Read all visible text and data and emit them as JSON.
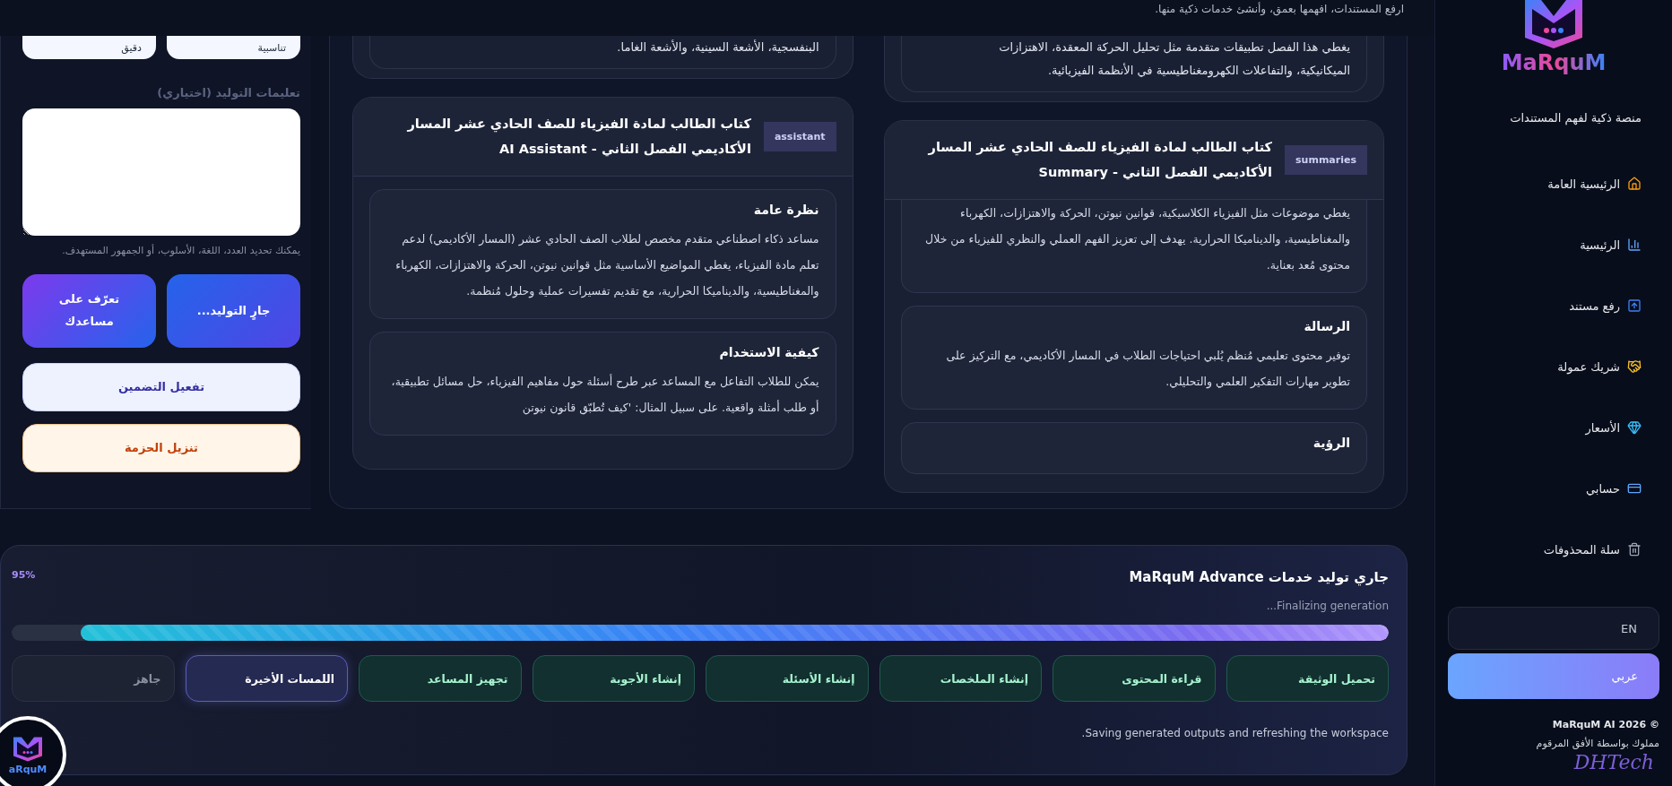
{
  "header": {
    "tagline": "ارفع المستندات، افهمها بعمق، وأنشئ خدمات ذكية منها."
  },
  "options_panel": {
    "choices": [
      {
        "label": "تناسبية"
      },
      {
        "label": "دقيق"
      }
    ],
    "instructions": {
      "label": "تعليمات التوليد (اختياري)",
      "hint": "يمكنك تحديد العدد، اللغة، الأسلوب، أو الجمهور المستهدف."
    },
    "actions": [
      {
        "label": "جارٍ التوليد...",
        "kind": "primary"
      },
      {
        "label": "تعرّف على مساعدك",
        "kind": "accent"
      },
      {
        "label": "تفعيل التضمين",
        "kind": "light"
      },
      {
        "label": "تنزيل الحزمة",
        "kind": "warm"
      }
    ]
  },
  "results": [
    {
      "previous_lines": [
        "يغطي هذا الفصل تطبيقات متقدمة مثل تحليل الحركة المعقدة، الاهتزازات",
        "الميكانيكية، والتفاعلات الكهرومغناطيسية في الأنظمة الفيزيائية."
      ],
      "badge": "summaries",
      "title": "كتاب الطالب لمادة الفيزياء للصف الحادي عشر المسار الأكاديمي الفصل الثاني - Summary",
      "sections": [
        {
          "text": "يغطي موضوعات مثل الفيزياء الكلاسيكية، قوانين نيوتن، الحركة والاهتزازات، الكهرباء والمغناطيسية، والديناميكا الحرارية. يهدف إلى تعزيز الفهم العملي والنظري للفيزياء من خلال محتوى مُعد بعناية."
        },
        {
          "heading": "الرسالة",
          "text": "توفير محتوى تعليمي مُنظم يُلبي احتياجات الطلاب في المسار الأكاديمي، مع التركيز على تطوير مهارات التفكير العلمي والتحليلي."
        },
        {
          "heading": "الرؤية"
        }
      ]
    },
    {
      "previous_lines": [
        "البنفسجية، الأشعة السينية، والأشعة الغاما."
      ],
      "badge": "assistant",
      "title": "كتاب الطالب لمادة الفيزياء للصف الحادي عشر المسار الأكاديمي الفصل الثاني - AI Assistant",
      "sections": [
        {
          "heading": "نظرة عامة",
          "text": "مساعد ذكاء اصطناعي متقدم مخصص لطلاب الصف الحادي عشر (المسار الأكاديمي) لدعم تعلم مادة الفيزياء، يغطي المواضيع الأساسية مثل قوانين نيوتن، الحركة والاهتزازات، الكهرباء والمغناطيسية، والديناميكا الحرارية، مع تقديم تفسيرات عملية وحلول مُنظمة."
        },
        {
          "heading": "كيفية الاستخدام",
          "text": "يمكن للطلاب التفاعل مع المساعد عبر طرح أسئلة حول مفاهيم الفيزياء، حل مسائل تطبيقية، أو طلب أمثلة واقعية. على سبيل المثال: 'كيف تُطبّق قانون نيوتن"
        }
      ]
    }
  ],
  "progress": {
    "title": "جاري توليد خدمات MaRquM Advance",
    "status": "Finalizing generation...",
    "percent": "95%",
    "level": 0.95,
    "steps": [
      {
        "label": "تحميل الوثيقة",
        "kind": "done"
      },
      {
        "label": "قراءة المحتوى",
        "kind": "done"
      },
      {
        "label": "إنشاء الملخصات",
        "kind": "done"
      },
      {
        "label": "إنشاء الأسئلة",
        "kind": "done"
      },
      {
        "label": "إنشاء الأجوبة",
        "kind": "done"
      },
      {
        "label": "تجهيز المساعد",
        "kind": "done"
      },
      {
        "label": "اللمسات الأخيرة",
        "kind": "active"
      },
      {
        "label": "جاهز",
        "kind": "pending"
      }
    ],
    "note": "Saving generated outputs and refreshing the workspace."
  },
  "sidebar": {
    "logo": "MaRquM",
    "tagline": "منصة ذكية لفهم المستندات",
    "items": [
      {
        "label": "الرئيسية العامة"
      },
      {
        "label": "الرئيسية"
      },
      {
        "label": "رفع مستند"
      },
      {
        "label": "شريك عمولة"
      },
      {
        "label": "الأسعار"
      },
      {
        "label": "حسابي"
      },
      {
        "label": "سلة المحذوفات"
      }
    ],
    "languages": [
      {
        "label": "EN",
        "selected": false
      },
      {
        "label": "عربي",
        "selected": true
      }
    ],
    "copyright": "© MaRquM AI 2026",
    "owner": "مملوك بواسطة الأفق المرقوم",
    "brand": "DHTech"
  },
  "floating_logo": {
    "text": "aRquM"
  }
}
